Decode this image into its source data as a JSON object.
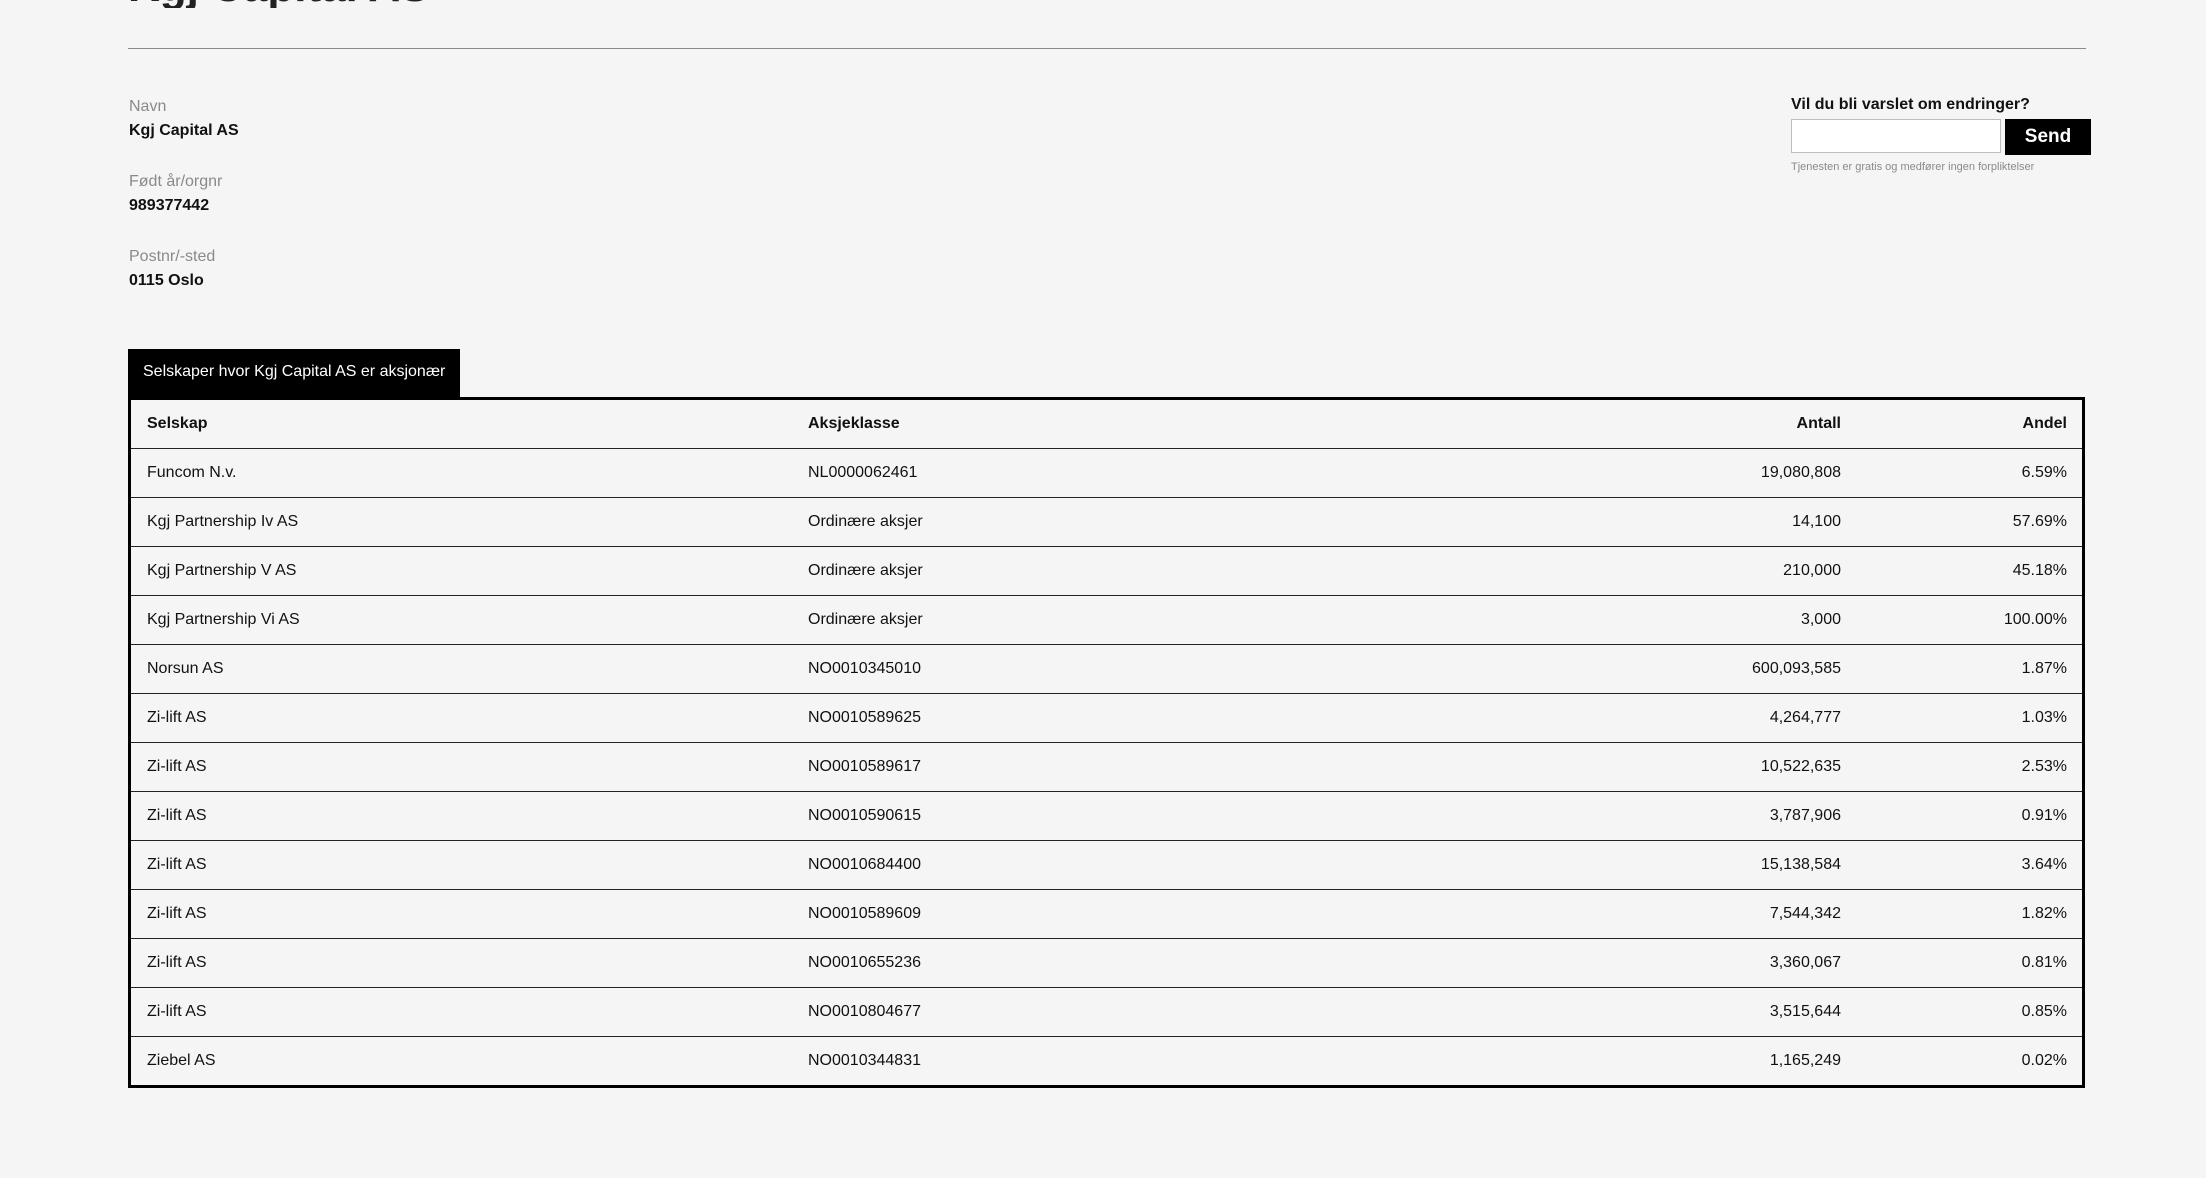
{
  "page": {
    "heading": "Kgj Capital AS"
  },
  "info": {
    "name_label": "Navn",
    "name_value": "Kgj Capital AS",
    "org_label": "Født år/orgnr",
    "org_value": "989377442",
    "postal_label": "Postnr/-sted",
    "postal_value": "0115 Oslo"
  },
  "notify": {
    "label": "Vil du bli varslet om endringer?",
    "input_value": "",
    "input_placeholder": "",
    "button_label": "Send",
    "hint": "Tjenesten er gratis og medfører ingen forpliktelser"
  },
  "tab": {
    "label": "Selskaper hvor Kgj Capital AS er aksjonær"
  },
  "table": {
    "headers": [
      "Selskap",
      "Aksjeklasse",
      "Antall",
      "Andel"
    ],
    "rows": [
      {
        "company": "Funcom N.v.",
        "share_class": "NL0000062461",
        "count": "19,080,808",
        "share": "6.59%"
      },
      {
        "company": "Kgj Partnership Iv AS",
        "share_class": "Ordinære aksjer",
        "count": "14,100",
        "share": "57.69%"
      },
      {
        "company": "Kgj Partnership V AS",
        "share_class": "Ordinære aksjer",
        "count": "210,000",
        "share": "45.18%"
      },
      {
        "company": "Kgj Partnership Vi AS",
        "share_class": "Ordinære aksjer",
        "count": "3,000",
        "share": "100.00%"
      },
      {
        "company": "Norsun AS",
        "share_class": "NO0010345010",
        "count": "600,093,585",
        "share": "1.87%"
      },
      {
        "company": "Zi-lift AS",
        "share_class": "NO0010589625",
        "count": "4,264,777",
        "share": "1.03%"
      },
      {
        "company": "Zi-lift AS",
        "share_class": "NO0010589617",
        "count": "10,522,635",
        "share": "2.53%"
      },
      {
        "company": "Zi-lift AS",
        "share_class": "NO0010590615",
        "count": "3,787,906",
        "share": "0.91%"
      },
      {
        "company": "Zi-lift AS",
        "share_class": "NO0010684400",
        "count": "15,138,584",
        "share": "3.64%"
      },
      {
        "company": "Zi-lift AS",
        "share_class": "NO0010589609",
        "count": "7,544,342",
        "share": "1.82%"
      },
      {
        "company": "Zi-lift AS",
        "share_class": "NO0010655236",
        "count": "3,360,067",
        "share": "0.81%"
      },
      {
        "company": "Zi-lift AS",
        "share_class": "NO0010804677",
        "count": "3,515,644",
        "share": "0.85%"
      },
      {
        "company": "Ziebel AS",
        "share_class": "NO0010344831",
        "count": "1,165,249",
        "share": "0.02%"
      }
    ]
  }
}
